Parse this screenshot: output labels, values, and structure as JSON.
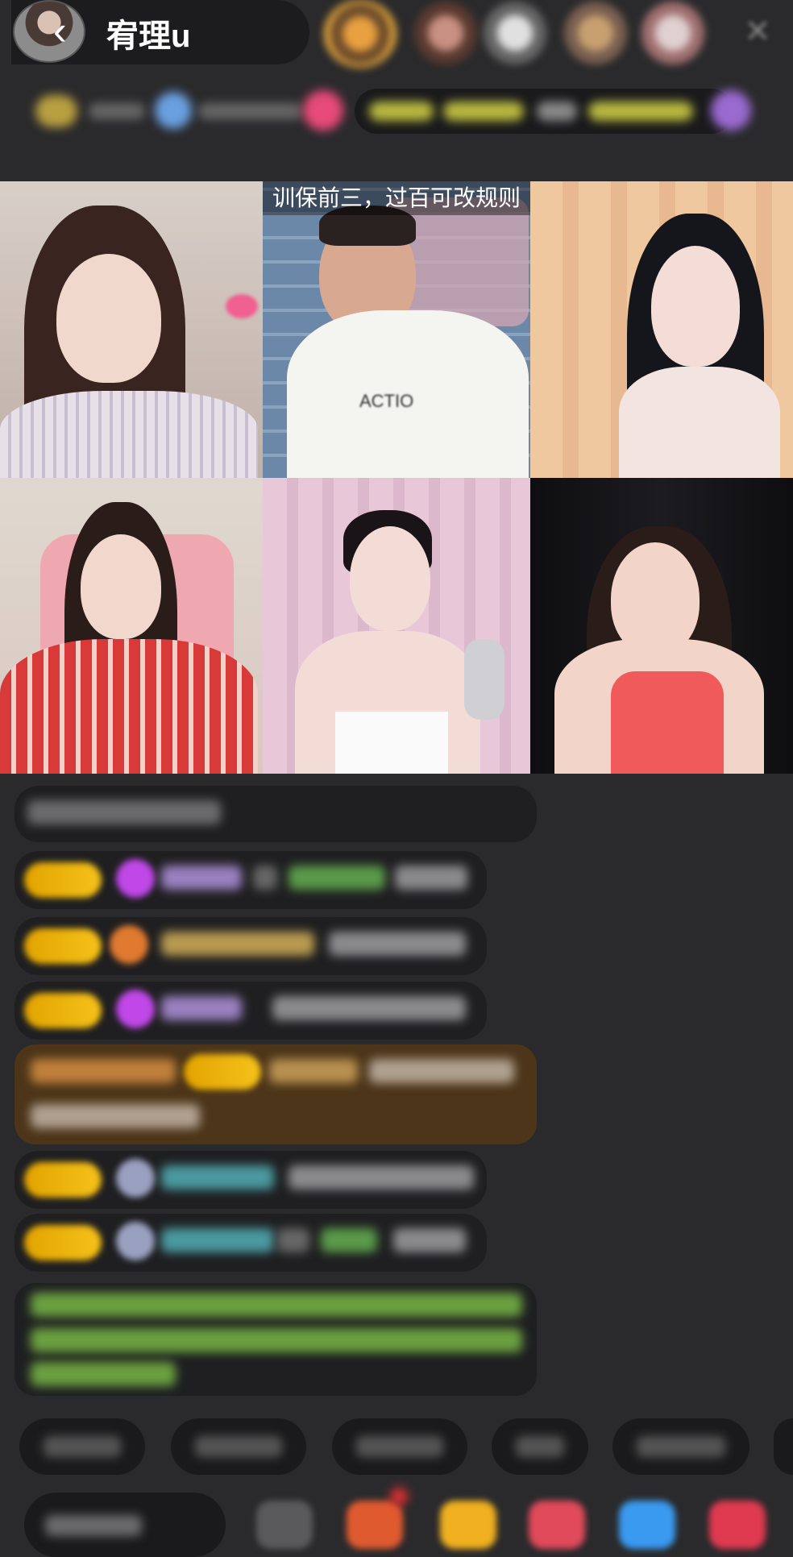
{
  "header": {
    "host_name": "宥理u",
    "back_icon": "chevron-left-icon",
    "close_icon": "close-icon"
  },
  "video": {
    "pk_banner": "训保前三，过百可改规则"
  },
  "colors": {
    "background": "#2a2a2c",
    "badge_gold": "#f6c21a",
    "chat_bubble": "#1f1f21",
    "highlight_bubble": "#5a3e1c",
    "green_text": "#7fd64a"
  }
}
